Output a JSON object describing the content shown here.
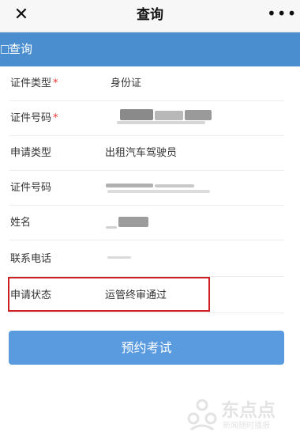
{
  "topbar": {
    "title": "查询",
    "close_icon": "close-icon",
    "more_icon": "more-icon",
    "more_glyph": "•••"
  },
  "section": {
    "title": "查询"
  },
  "form": {
    "rows": [
      {
        "label": "证件类型",
        "required": true,
        "value": "身份证"
      },
      {
        "label": "证件号码",
        "required": true,
        "value": ""
      },
      {
        "label": "申请类型",
        "required": false,
        "value": "出租汽车驾驶员"
      },
      {
        "label": "证件号码",
        "required": false,
        "value": ""
      },
      {
        "label": "姓名",
        "required": false,
        "value": ""
      },
      {
        "label": "联系电话",
        "required": false,
        "value": ""
      },
      {
        "label": "申请状态",
        "required": false,
        "value": "运管终审通过"
      }
    ],
    "required_mark": "*"
  },
  "submit": {
    "label": "预约考试"
  },
  "watermark": {
    "name": "东点点",
    "sub": "新闻随时播报"
  },
  "colors": {
    "header_bg": "#4a8ed0",
    "button_bg": "#5a9be0",
    "required": "#e33333",
    "highlight": "#cc1f1f"
  }
}
